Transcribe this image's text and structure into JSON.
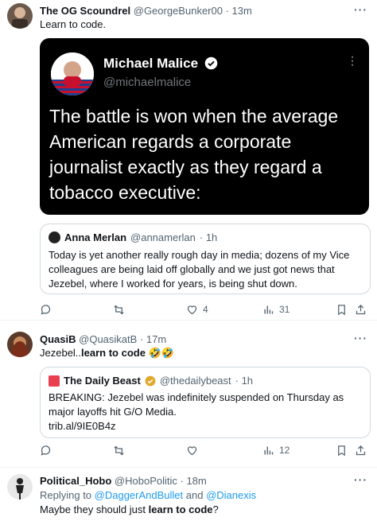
{
  "tweets": [
    {
      "name": "The OG Scoundrel",
      "handle": "@GeorgeBunker00",
      "time": "· 13m",
      "text": "Learn to code.",
      "image_card": {
        "name": "Michael Malice",
        "handle": "@michaelmalice",
        "text": "The battle is won when the average American regards a corporate journalist exactly as they regard a tobacco executive:"
      },
      "quote": {
        "name": "Anna Merlan",
        "handle": "@annamerlan",
        "time": "· 1h",
        "text": "Today is yet another really rough day in media; dozens of my Vice colleagues are being laid off globally and we just got news that Jezebel, where I worked for years, is being shut down."
      },
      "stats": {
        "replies": "",
        "retweets": "",
        "likes": "4",
        "views": "31"
      }
    },
    {
      "name": "QuasiB",
      "handle": "@QuasikatB",
      "time": "· 17m",
      "text_prefix": "Jezebel..",
      "text_bold": "learn to code",
      "text_emoji": " 🤣🤣",
      "quote": {
        "name": "The Daily Beast",
        "handle": "@thedailybeast",
        "time": "· 1h",
        "text": "BREAKING: Jezebel was indefinitely suspended on Thursday as major layoffs hit G/O Media.",
        "link": "trib.al/9IE0B4z"
      },
      "stats": {
        "replies": "",
        "retweets": "",
        "likes": "",
        "views": "12"
      }
    },
    {
      "name": "Political_Hobo",
      "handle": "@HoboPolitic",
      "time": "· 18m",
      "replying_prefix": "Replying to ",
      "replying_user1": "@DaggerAndBullet",
      "replying_and": " and ",
      "replying_user2": "@Dianexis",
      "text_prefix": "Maybe they should just ",
      "text_bold": "learn to code",
      "text_suffix": "?"
    }
  ],
  "colors": {
    "link": "#1d9bf0",
    "muted": "#536471",
    "border": "#cfd9de",
    "card_bg": "#000000",
    "verified": "#e0a82e"
  }
}
